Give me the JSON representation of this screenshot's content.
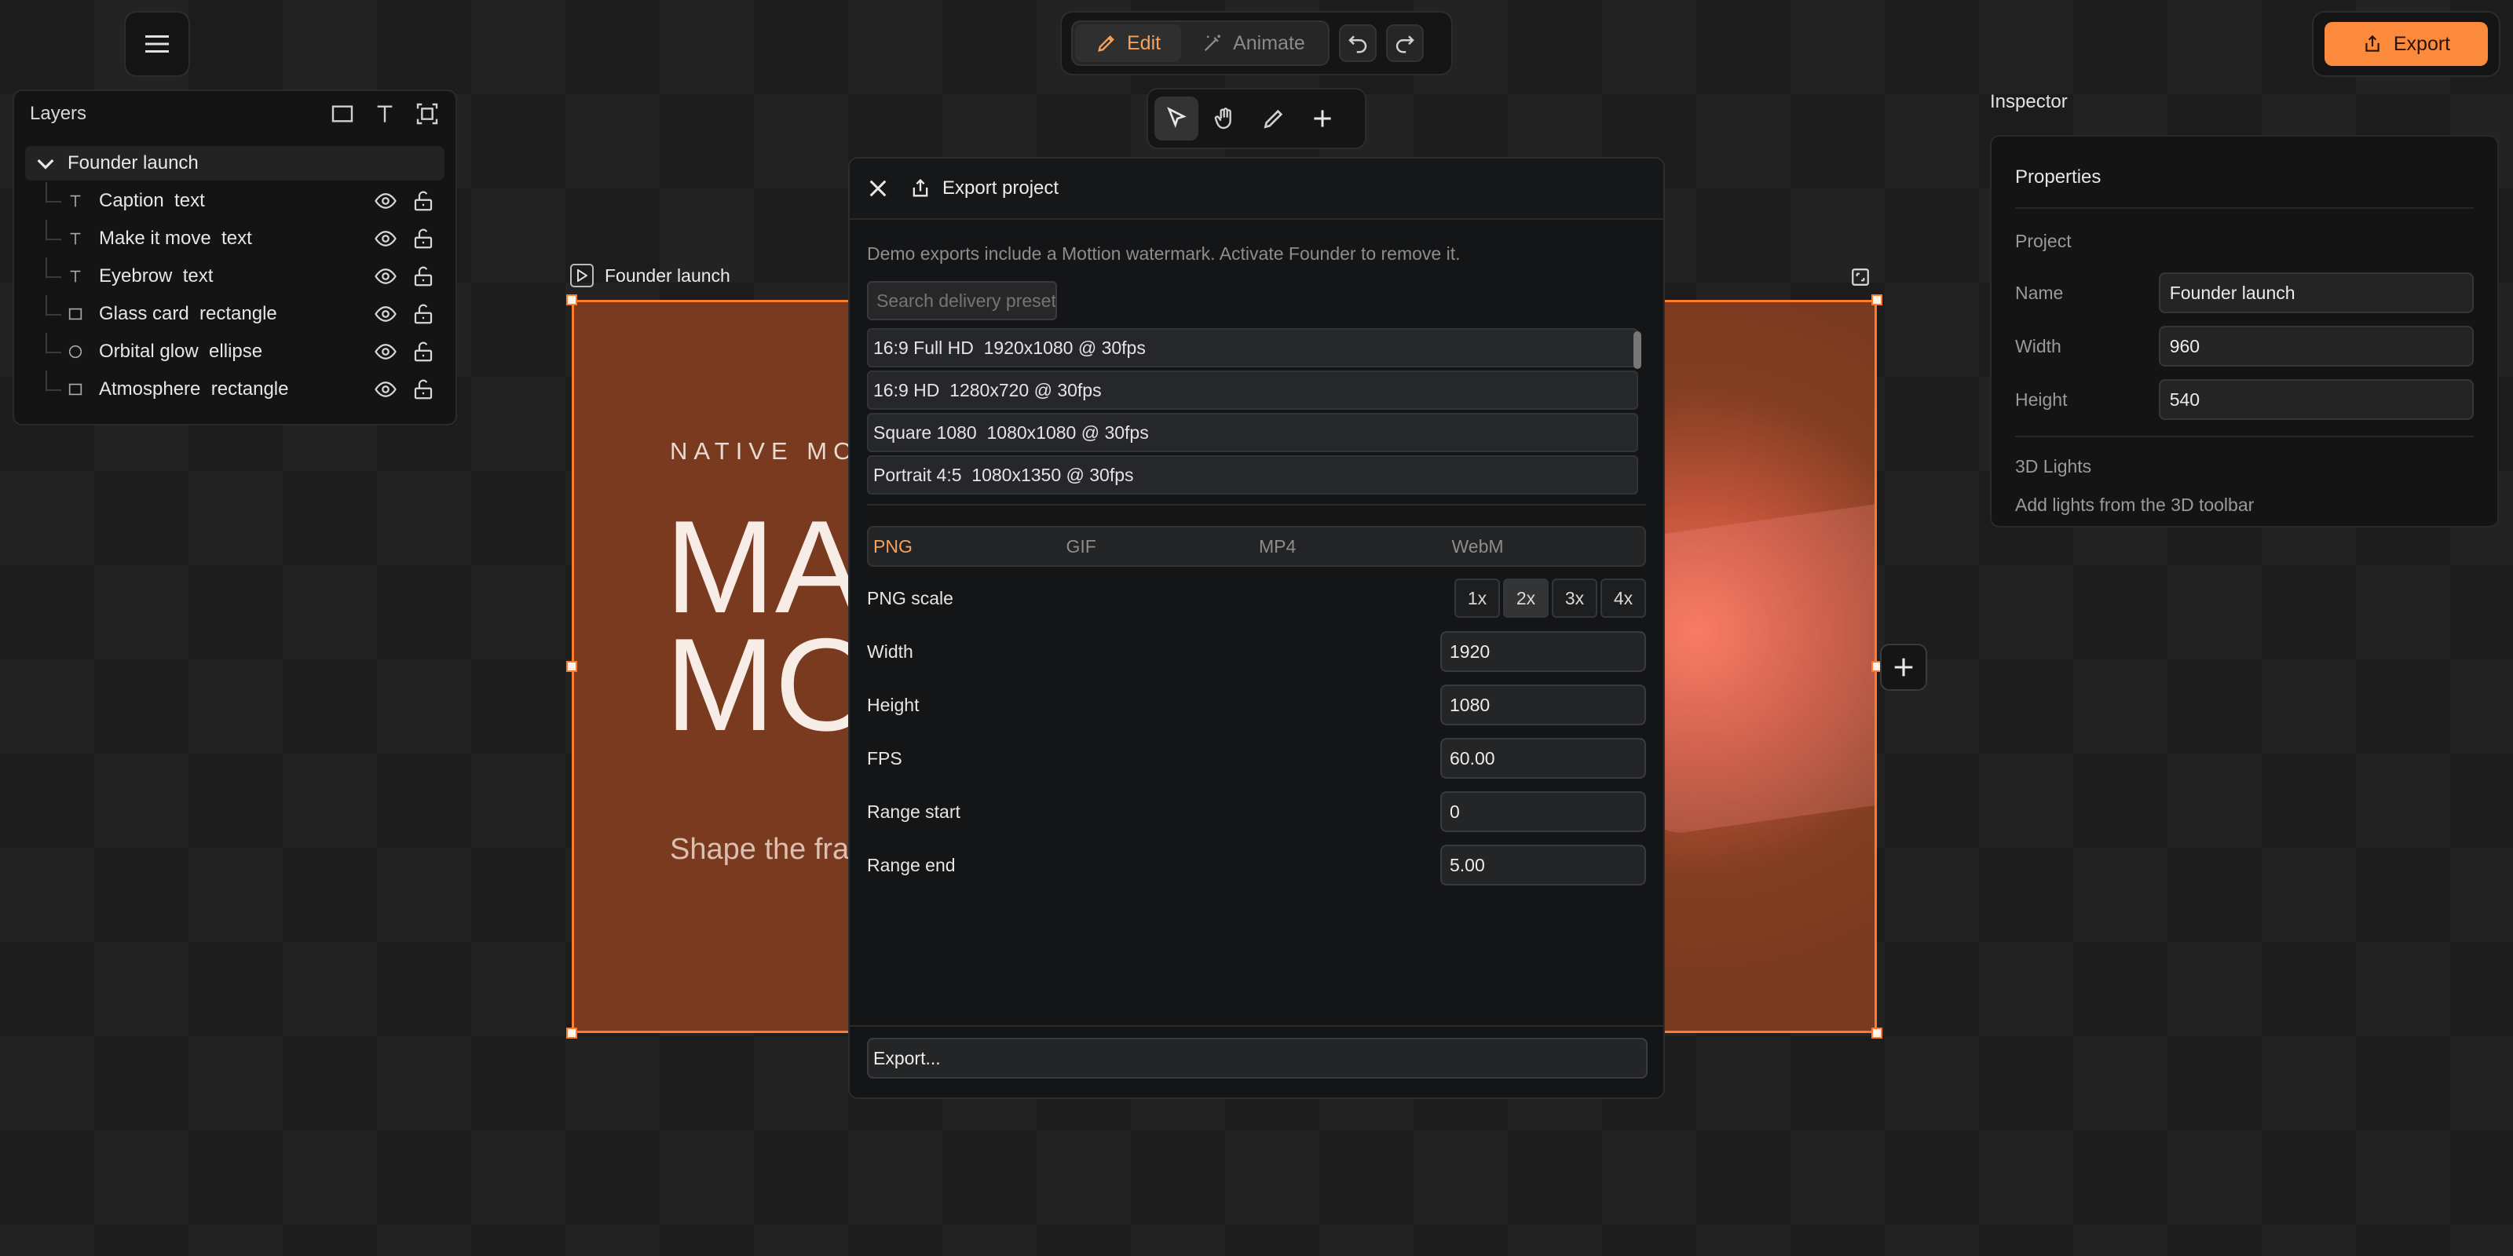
{
  "modes": {
    "edit_label": "Edit",
    "animate_label": "Animate"
  },
  "toolbar": {
    "export_label": "Export"
  },
  "layers": {
    "title": "Layers",
    "root": "Founder launch",
    "items": [
      {
        "name": "Caption  text",
        "type": "text"
      },
      {
        "name": "Make it move  text",
        "type": "text"
      },
      {
        "name": "Eyebrow  text",
        "type": "text"
      },
      {
        "name": "Glass card  rectangle",
        "type": "rectangle"
      },
      {
        "name": "Orbital glow  ellipse",
        "type": "ellipse"
      },
      {
        "name": "Atmosphere  rectangle",
        "type": "rectangle"
      }
    ]
  },
  "canvas": {
    "frame_label": "Founder launch",
    "eyebrow": "NATIVE MOT",
    "headline_line1": "MA",
    "headline_line2": "MO",
    "caption": "Shape the fra"
  },
  "inspector": {
    "title": "Inspector",
    "section": "Properties",
    "project_label": "Project",
    "name_label": "Name",
    "name_value": "Founder launch",
    "width_label": "Width",
    "width_value": "960",
    "height_label": "Height",
    "height_value": "540",
    "lights_label": "3D Lights",
    "lights_note": "Add lights from the 3D toolbar"
  },
  "dialog": {
    "title": "Export project",
    "note": "Demo exports include a Mottion watermark. Activate Founder to remove it.",
    "search_placeholder": "Search delivery presets",
    "presets": [
      "16:9 Full HD  1920x1080 @ 30fps",
      "16:9 HD  1280x720 @ 30fps",
      "Square 1080  1080x1080 @ 30fps",
      "Portrait 4:5  1080x1350 @ 30fps"
    ],
    "formats": [
      "PNG",
      "GIF",
      "MP4",
      "WebM"
    ],
    "active_format": "PNG",
    "scale_label": "PNG scale",
    "scales": [
      "1x",
      "2x",
      "3x",
      "4x"
    ],
    "active_scale": "2x",
    "width_label": "Width",
    "width_value": "1920",
    "height_label": "Height",
    "height_value": "1080",
    "fps_label": "FPS",
    "fps_value": "60.00",
    "range_start_label": "Range start",
    "range_start_value": "0",
    "range_end_label": "Range end",
    "range_end_value": "5.00",
    "export_button": "Export..."
  },
  "colors": {
    "accent": "#fb8a3c",
    "accent_text": "#f7a25b",
    "selection": "#ff7a2a"
  },
  "icons": [
    "hamburger-icon",
    "pencil-icon",
    "wand-icon",
    "undo-icon",
    "redo-icon",
    "pointer-icon",
    "hand-icon",
    "pen-icon",
    "plus-icon",
    "share-icon",
    "rectangle-icon",
    "text-icon",
    "frame-icon",
    "chevron-down-icon",
    "eye-icon",
    "lock-icon",
    "ellipse-icon",
    "play-icon",
    "fit-icon",
    "close-icon"
  ]
}
